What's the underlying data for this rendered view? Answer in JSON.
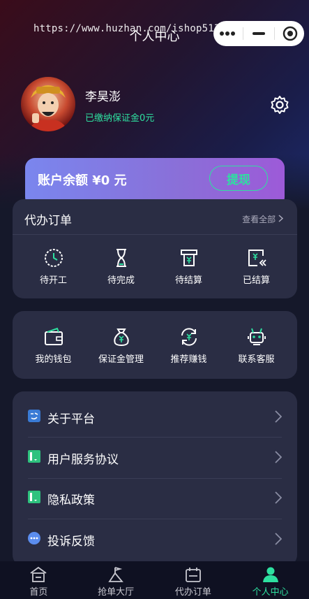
{
  "watermark": "https://www.huzhan.com/ishop51386",
  "header": {
    "title": "个人中心"
  },
  "user": {
    "name": "李昊澎",
    "status": "已缴纳保证金0元"
  },
  "balance": {
    "text": "账户余额 ¥0 元",
    "withdraw_label": "提现"
  },
  "orders": {
    "title": "代办订单",
    "view_all": "查看全部",
    "items": [
      {
        "label": "待开工",
        "icon": "clock-icon"
      },
      {
        "label": "待完成",
        "icon": "hourglass-icon"
      },
      {
        "label": "待结算",
        "icon": "receipt-icon"
      },
      {
        "label": "已结算",
        "icon": "settled-icon"
      }
    ]
  },
  "services": {
    "items": [
      {
        "label": "我的钱包",
        "icon": "wallet-icon"
      },
      {
        "label": "保证金管理",
        "icon": "money-bag-icon"
      },
      {
        "label": "推荐赚钱",
        "icon": "refresh-yen-icon"
      },
      {
        "label": "联系客服",
        "icon": "robot-icon"
      }
    ]
  },
  "menu": {
    "items": [
      {
        "label": "关于平台",
        "icon": "about-icon"
      },
      {
        "label": "用户服务协议",
        "icon": "agreement-icon"
      },
      {
        "label": "隐私政策",
        "icon": "privacy-icon"
      },
      {
        "label": "投诉反馈",
        "icon": "feedback-icon"
      }
    ]
  },
  "tabbar": {
    "items": [
      {
        "label": "首页",
        "icon": "home-icon"
      },
      {
        "label": "抢单大厅",
        "icon": "flag-icon"
      },
      {
        "label": "代办订单",
        "icon": "calendar-icon"
      },
      {
        "label": "个人中心",
        "icon": "person-icon"
      }
    ],
    "active": "个人中心"
  },
  "colors": {
    "accent": "#2ee0a0",
    "card": "#2a2d44",
    "background": "#15182a"
  }
}
